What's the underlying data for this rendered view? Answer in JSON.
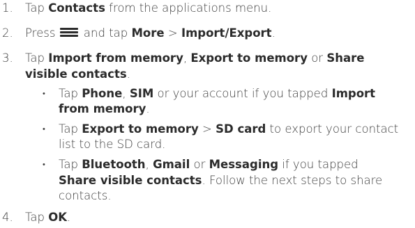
{
  "steps": [
    {
      "num": "1.",
      "parts": [
        "Tap ",
        "Contacts",
        " from the applications menu."
      ]
    },
    {
      "num": "2.",
      "parts": [
        "Press ",
        " and tap ",
        "More",
        " > ",
        "Import/Export",
        "."
      ],
      "icon": "menu-icon"
    },
    {
      "num": "3.",
      "line1": [
        "Tap ",
        "Import from memory",
        ", ",
        "Export to memory",
        " or ",
        "Share"
      ],
      "line2": [
        "visible contacts",
        "."
      ]
    },
    {
      "num": "4.",
      "parts": [
        "Tap ",
        "OK",
        "."
      ]
    }
  ],
  "bullets": [
    {
      "symbol": "•",
      "line1": [
        "Tap ",
        "Phone",
        ", ",
        "SIM",
        " or your account if you tapped ",
        "Import"
      ],
      "line2": [
        "from memory",
        "."
      ]
    },
    {
      "symbol": "•",
      "line1": [
        "Tap ",
        "Export to memory",
        " > ",
        "SD card",
        " to export your contact"
      ],
      "line2": [
        "list to the SD card."
      ]
    },
    {
      "symbol": "•",
      "line1": [
        "Tap ",
        "Bluetooth",
        ", ",
        "Gmail",
        " or ",
        "Messaging",
        " if you tapped"
      ],
      "line2": [
        "Share visible contacts",
        ". Follow the next steps to share"
      ],
      "line3": [
        "contacts."
      ]
    }
  ]
}
